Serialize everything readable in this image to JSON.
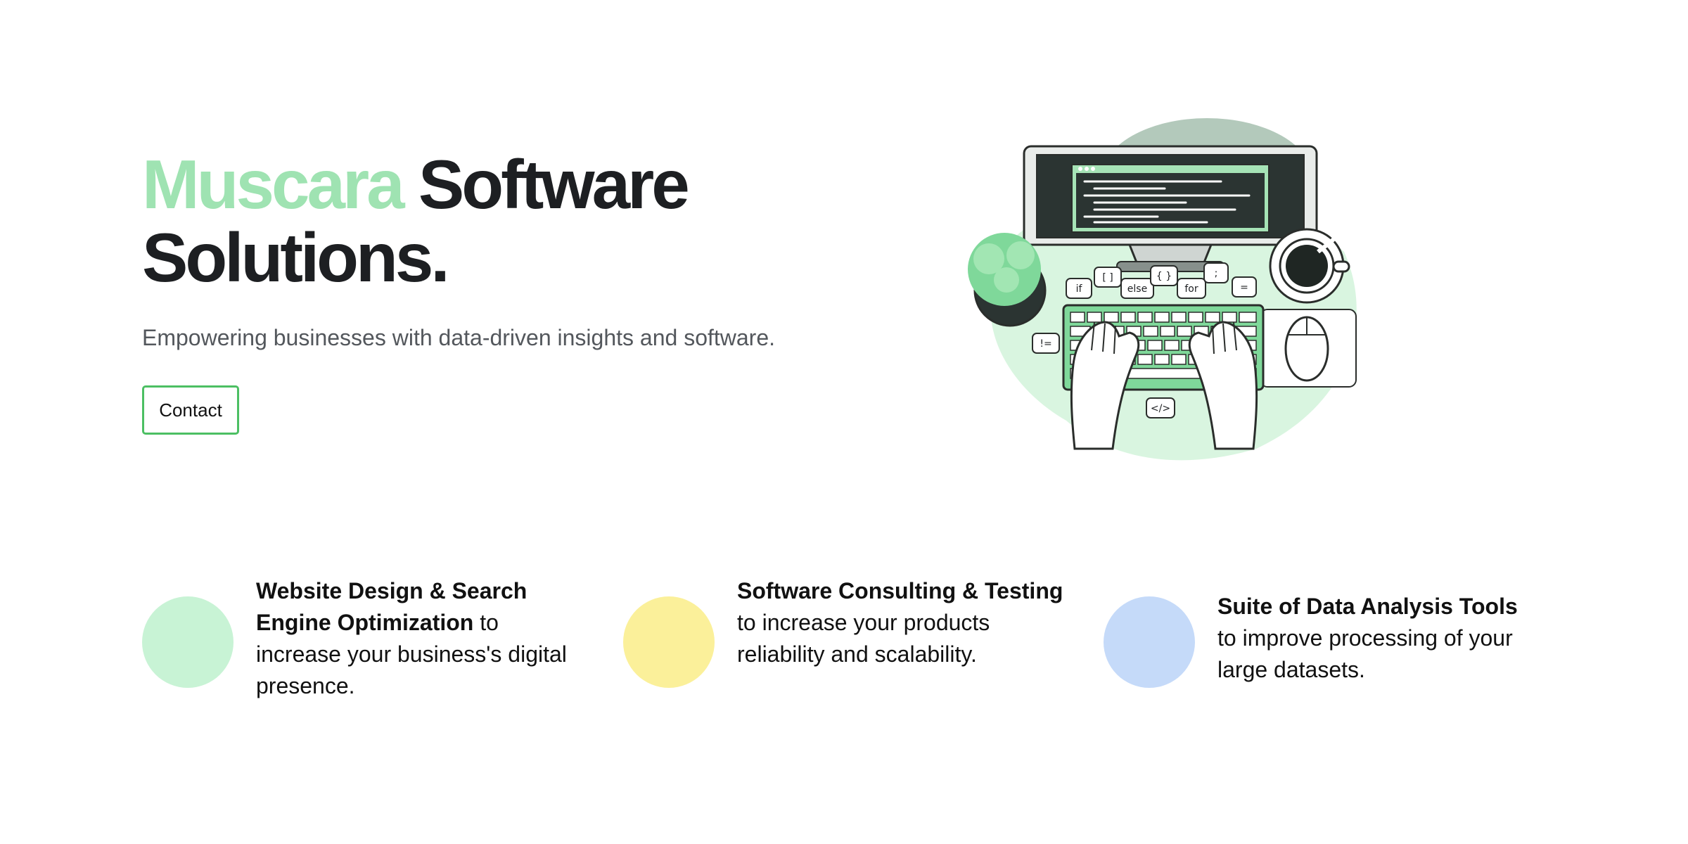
{
  "hero": {
    "brand": "Muscara",
    "title_rest": "Software",
    "title_line2": "Solutions.",
    "tagline": "Empowering businesses with data-driven insights and software.",
    "contact_label": "Contact"
  },
  "illustration": {
    "tokens": [
      "if",
      "[ ]",
      "else",
      "{ }",
      "for",
      ";",
      "=",
      "!=",
      "</>"
    ]
  },
  "features": [
    {
      "title": "Website Design & Search Engine Optimization",
      "desc": " to increase your business's digital presence.",
      "color": "#c8f3d5"
    },
    {
      "title": "Software Consulting & Testing",
      "desc": " to increase your products reliability and scalability.",
      "color": "#fbf09a"
    },
    {
      "title": "Suite of Data Analysis Tools",
      "desc": "to improve processing of your large datasets.",
      "color": "#c5daf9"
    }
  ],
  "colors": {
    "brand_green": "#9fe3b2",
    "button_border": "#4cbf63",
    "text_dark": "#1d1f22"
  }
}
